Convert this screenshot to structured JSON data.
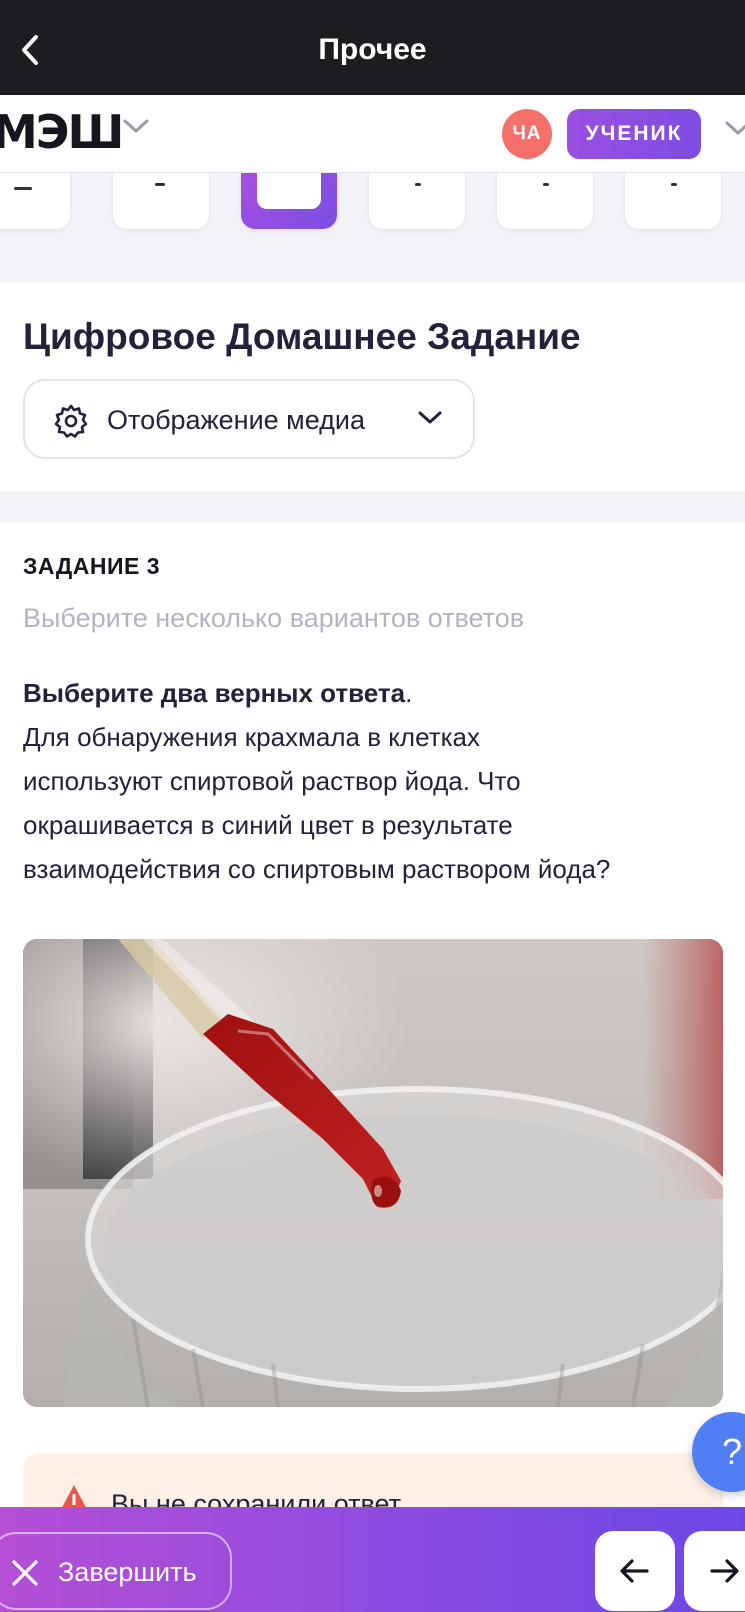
{
  "topbar": {
    "title": "Прочее"
  },
  "appbar": {
    "logo": "МЭШ",
    "avatar_initials": "ЧА",
    "role_label": "УЧЕНИК"
  },
  "header": {
    "title": "Цифровое Домашнее Задание",
    "media_button_label": "Отображение медиа"
  },
  "task": {
    "label": "ЗАДАНИЕ 3",
    "subtitle": "Выберите несколько вариантов ответов",
    "instruction_bold": "Выберите два верных ответа",
    "instruction_end": ".",
    "question_lines": [
      "Для обнаружения крахмала в клетках",
      "используют спиртовой раствор йода. Что",
      "окрашивается в синий цвет в результате",
      "взаимодействия со спиртовым раствором йода?"
    ]
  },
  "warning": {
    "text": "Вы не сохранили ответ"
  },
  "help": {
    "label": "?"
  },
  "bottombar": {
    "finish_label": "Завершить"
  },
  "colors": {
    "accent_purple": "#8a4be0",
    "avatar_red": "#f4706b",
    "help_blue": "#4f7ef5",
    "warning_bg": "#fdf0e6",
    "topbar_bg": "#1c1c21"
  }
}
